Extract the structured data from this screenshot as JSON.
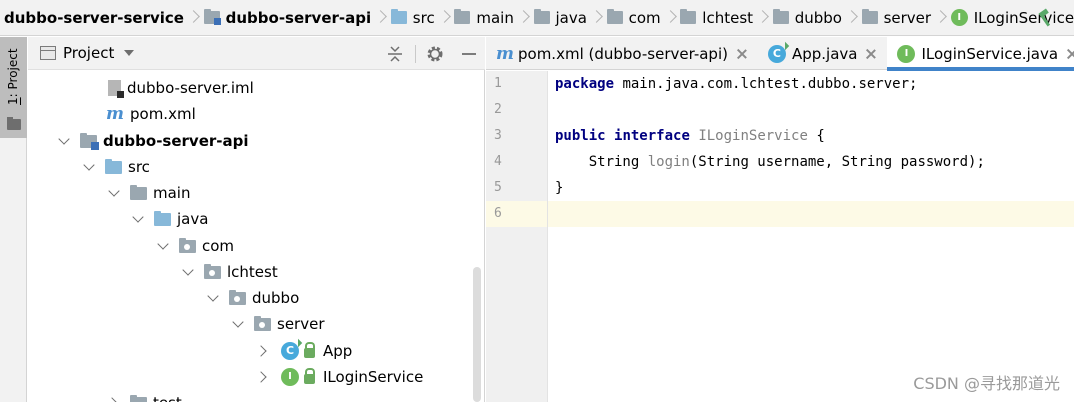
{
  "breadcrumb": {
    "items": [
      {
        "label": "dubbo-server-service",
        "icon": "none",
        "bold": true
      },
      {
        "label": "dubbo-server-api",
        "icon": "module-folder-icon",
        "bold": true
      },
      {
        "label": "src",
        "icon": "source-folder-icon"
      },
      {
        "label": "main",
        "icon": "folder-icon"
      },
      {
        "label": "java",
        "icon": "folder-icon"
      },
      {
        "label": "com",
        "icon": "folder-icon"
      },
      {
        "label": "lchtest",
        "icon": "folder-icon"
      },
      {
        "label": "dubbo",
        "icon": "folder-icon"
      },
      {
        "label": "server",
        "icon": "folder-icon"
      },
      {
        "label": "ILoginService",
        "icon": "interface-icon",
        "badge": "I"
      }
    ]
  },
  "tool_strip": {
    "number": "1",
    "label": ": Project"
  },
  "project_panel": {
    "title": "Project",
    "tree": [
      {
        "label": "dubbo-server.iml",
        "icon": "iml-file-icon"
      },
      {
        "label": "pom.xml",
        "icon": "maven-icon",
        "badge": "m"
      },
      {
        "label": "dubbo-server-api",
        "icon": "module-folder-icon",
        "expanded": true
      },
      {
        "label": "src",
        "icon": "source-folder-icon",
        "expanded": true
      },
      {
        "label": "main",
        "icon": "folder-icon",
        "expanded": true
      },
      {
        "label": "java",
        "icon": "folder-icon",
        "expanded": true
      },
      {
        "label": "com",
        "icon": "package-icon",
        "expanded": true
      },
      {
        "label": "lchtest",
        "icon": "package-icon",
        "expanded": true
      },
      {
        "label": "dubbo",
        "icon": "package-icon",
        "expanded": true
      },
      {
        "label": "server",
        "icon": "package-icon",
        "expanded": true
      },
      {
        "label": "App",
        "icon": "class-icon",
        "badge": "C",
        "expanded": false
      },
      {
        "label": "ILoginService",
        "icon": "interface-icon",
        "badge": "I",
        "expanded": false
      },
      {
        "label": "test",
        "icon": "folder-icon",
        "expanded": false
      }
    ]
  },
  "editor": {
    "tabs": [
      {
        "label": "pom.xml (dubbo-server-api)",
        "icon": "maven-icon",
        "badge": "m",
        "active": false
      },
      {
        "label": "App.java",
        "icon": "class-icon",
        "badge": "C",
        "active": false
      },
      {
        "label": "ILoginService.java",
        "icon": "interface-icon",
        "badge": "I",
        "active": true
      }
    ],
    "line_numbers": [
      "1",
      "2",
      "3",
      "4",
      "5",
      "6"
    ],
    "current_line": 6,
    "code": {
      "l1_kw": "package",
      "l1_rest": " main.java.com.lchtest.dubbo.server;",
      "l3_kw1": "public",
      "l3_kw2": "interface",
      "l3_name": "ILoginService",
      "l3_rest": " {",
      "l4_indent": "    String ",
      "l4_method": "login",
      "l4_rest": "(String username, String password);",
      "l5": "}"
    }
  },
  "watermark": "CSDN @寻找那道光",
  "colors": {
    "keyword": "#000080",
    "declaration": "#808080",
    "active_tab_underline": "#4083c9",
    "current_line": "#fdfae6"
  }
}
